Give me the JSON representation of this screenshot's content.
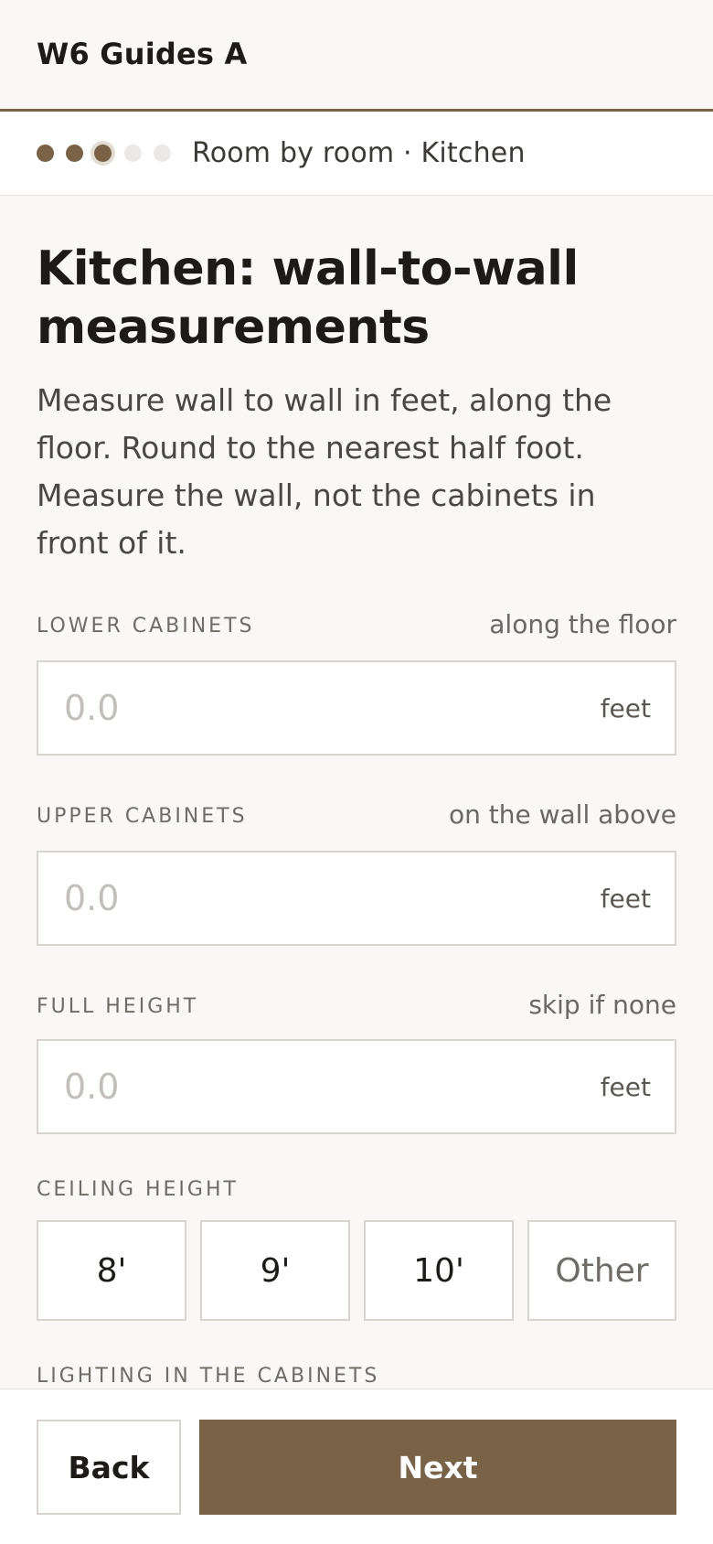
{
  "header": {
    "title": "W6 Guides A"
  },
  "progress": {
    "steps": [
      "done",
      "done",
      "current",
      "todo",
      "todo"
    ],
    "label": "Room by room · Kitchen"
  },
  "main": {
    "heading": "Kitchen: wall-to-wall measurements",
    "intro": "Measure wall to wall in feet, along the floor. Round to the nearest half foot. Measure the wall, not the cabinets in front of it.",
    "fields": [
      {
        "label": "LOWER CABINETS",
        "hint": "along the floor",
        "placeholder": "0.0",
        "unit": "feet"
      },
      {
        "label": "UPPER CABINETS",
        "hint": "on the wall above",
        "placeholder": "0.0",
        "unit": "feet"
      },
      {
        "label": "FULL HEIGHT",
        "hint": "skip if none",
        "placeholder": "0.0",
        "unit": "feet"
      }
    ],
    "ceiling": {
      "label": "CEILING HEIGHT",
      "options": [
        "8'",
        "9'",
        "10'",
        "Other"
      ]
    },
    "next_section_label": "LIGHTING IN THE CABINETS"
  },
  "footer": {
    "back_label": "Back",
    "next_label": "Next"
  },
  "colors": {
    "accent": "#7a6246",
    "background": "#f9f8f6",
    "border": "#d8d5d0"
  }
}
